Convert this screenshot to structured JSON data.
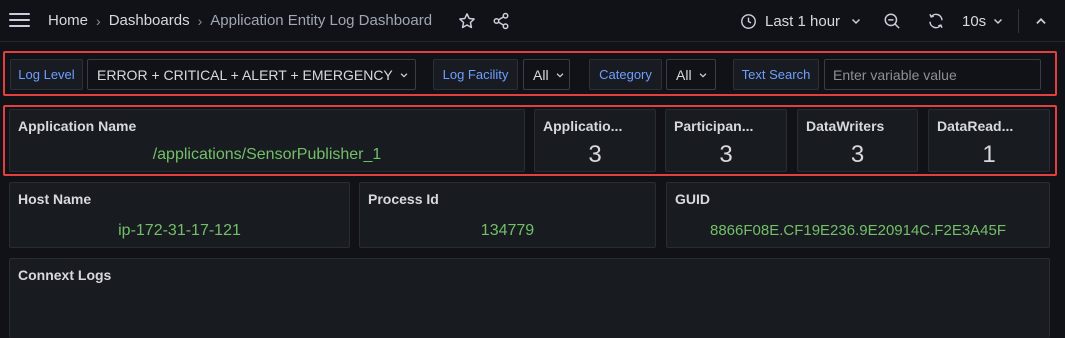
{
  "breadcrumb": {
    "home": "Home",
    "dashboards": "Dashboards",
    "current": "Application Entity Log Dashboard"
  },
  "toolbar": {
    "time_range": "Last 1 hour",
    "refresh_interval": "10s"
  },
  "variables": {
    "log_level_label": "Log Level",
    "log_level_value": "ERROR + CRITICAL + ALERT + EMERGENCY",
    "log_facility_label": "Log Facility",
    "log_facility_value": "All",
    "category_label": "Category",
    "category_value": "All",
    "text_search_label": "Text Search",
    "text_search_placeholder": "Enter variable value"
  },
  "stats": {
    "application_name": {
      "title": "Application Name",
      "value": "/applications/SensorPublisher_1"
    },
    "applications": {
      "title": "Applicatio...",
      "value": "3"
    },
    "participants": {
      "title": "Participan...",
      "value": "3"
    },
    "datawriters": {
      "title": "DataWriters",
      "value": "3"
    },
    "datareaders": {
      "title": "DataRead...",
      "value": "1"
    }
  },
  "details": {
    "host_name": {
      "title": "Host Name",
      "value": "ip-172-31-17-121"
    },
    "process_id": {
      "title": "Process Id",
      "value": "134779"
    },
    "guid": {
      "title": "GUID",
      "value": "8866F08E.CF19E236.9E20914C.F2E3A45F"
    }
  },
  "logs_panel": {
    "title": "Connext Logs"
  },
  "colors": {
    "background": "#111217",
    "panel": "#181b1f",
    "highlight_border": "#e0413f",
    "variable_label": "#6e9fff",
    "value_green": "#73bf69"
  }
}
